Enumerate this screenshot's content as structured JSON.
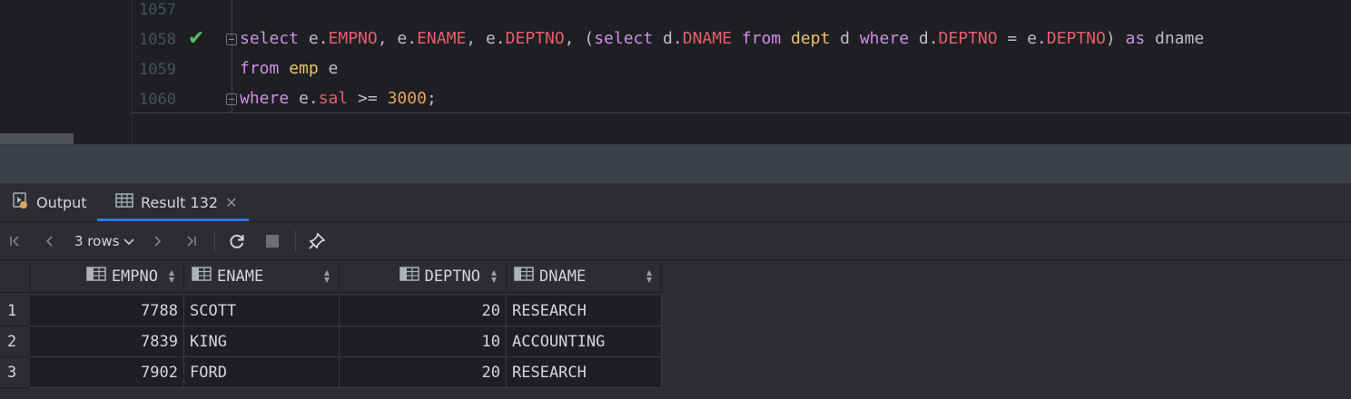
{
  "editor": {
    "lines": [
      {
        "no": "1057"
      },
      {
        "no": "1058"
      },
      {
        "no": "1059"
      },
      {
        "no": "1060"
      }
    ],
    "code": {
      "l1": {
        "t1": "select",
        "t2": " e.",
        "t3": "EMPNO",
        "t4": ", e.",
        "t5": "ENAME",
        "t6": ", e.",
        "t7": "DEPTNO",
        "t8": ", (",
        "t9": "select",
        "t10": " d.",
        "t11": "DNAME",
        "t12": " ",
        "t13": "from",
        "t14": " ",
        "t15": "dept",
        "t16": " d ",
        "t17": "where",
        "t18": " d.",
        "t19": "DEPTNO",
        "t20": " = e.",
        "t21": "DEPTNO",
        "t22": ") ",
        "t23": "as",
        "t24": " dname"
      },
      "l2": {
        "t1": "from",
        "t2": " ",
        "t3": "emp",
        "t4": " e"
      },
      "l3": {
        "t1": "where",
        "t2": " e.",
        "t3": "sal",
        "t4": " >= ",
        "t5": "3000",
        "t6": ";"
      }
    }
  },
  "tabs": {
    "output_label": "Output",
    "result_label": "Result 132"
  },
  "toolbar": {
    "rows_label": "3 rows"
  },
  "grid": {
    "columns": [
      "EMPNO",
      "ENAME",
      "DEPTNO",
      "DNAME"
    ],
    "rows": [
      {
        "n": "1",
        "empno": "7788",
        "ename": "SCOTT",
        "deptno": "20",
        "dname": "RESEARCH"
      },
      {
        "n": "2",
        "empno": "7839",
        "ename": "KING",
        "deptno": "10",
        "dname": "ACCOUNTING"
      },
      {
        "n": "3",
        "empno": "7902",
        "ename": "FORD",
        "deptno": "20",
        "dname": "RESEARCH"
      }
    ]
  },
  "colors": {
    "keyword": "#cf8ee8",
    "column": "#e85d6f",
    "table": "#e8c46a",
    "number": "#e6a062",
    "accent": "#3574f0",
    "success": "#5fb865"
  },
  "icons": [
    "check-icon",
    "output-icon",
    "table-icon",
    "close-icon",
    "first-page-icon",
    "prev-page-icon",
    "chevron-down-icon",
    "next-page-icon",
    "last-page-icon",
    "refresh-icon",
    "stop-icon",
    "pin-icon",
    "column-icon",
    "sort-icon"
  ]
}
